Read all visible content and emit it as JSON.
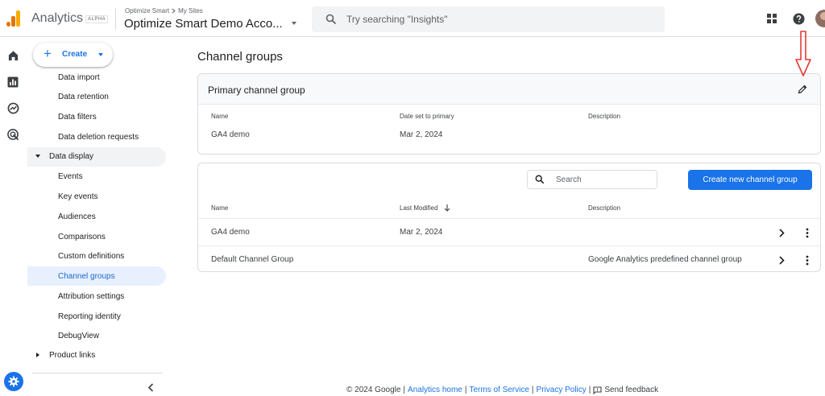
{
  "topbar": {
    "app_name": "Analytics",
    "alpha_label": "ALPHA",
    "breadcrumb_parent": "Optimize Smart",
    "breadcrumb_child": "My Sites",
    "account_title": "Optimize Smart Demo Acco...",
    "search_placeholder": "Try searching \"Insights\""
  },
  "create": {
    "label": "Create"
  },
  "nav": {
    "items_top": [
      "Data import",
      "Data retention",
      "Data filters",
      "Data deletion requests"
    ],
    "section_data_display": "Data display",
    "items_display": [
      "Events",
      "Key events",
      "Audiences",
      "Comparisons",
      "Custom definitions",
      "Channel groups",
      "Attribution settings",
      "Reporting identity",
      "DebugView"
    ],
    "section_product_links": "Product links"
  },
  "main": {
    "title": "Channel groups",
    "primary": {
      "title": "Primary channel group",
      "headers": [
        "Name",
        "Date set to primary",
        "Description"
      ],
      "row": [
        "GA4 demo",
        "Mar 2, 2024",
        ""
      ]
    },
    "list": {
      "search_placeholder": "Search",
      "create_button": "Create new channel group",
      "headers": [
        "Name",
        "Last Modified",
        "Description"
      ],
      "rows": [
        [
          "GA4 demo",
          "Mar 2, 2024",
          ""
        ],
        [
          "Default Channel Group",
          "",
          "Google Analytics predefined channel group"
        ]
      ]
    }
  },
  "footer": {
    "copyright": "© 2024 Google",
    "sep": "|",
    "analytics_home": "Analytics home",
    "terms": "Terms of Service",
    "privacy": "Privacy Policy",
    "feedback": "Send feedback"
  },
  "colors": {
    "accent": "#1a73e8",
    "annotation_arrow": "#e53935",
    "logo": "#f9ab00"
  }
}
